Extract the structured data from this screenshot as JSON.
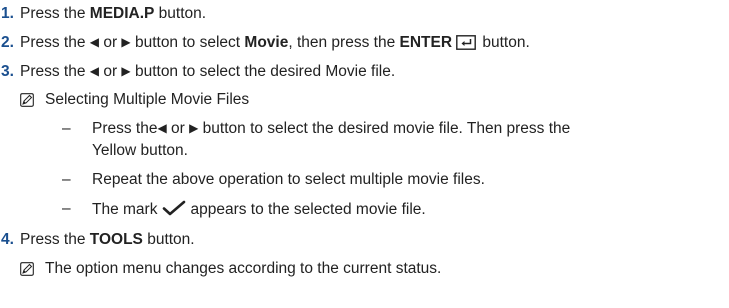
{
  "steps": [
    {
      "number": "1.",
      "pre": "Press the ",
      "bold": "MEDIA.P",
      "post": " button."
    },
    {
      "number": "2.",
      "pre": "Press the ",
      "left_arrow": "◀",
      "or": " or ",
      "right_arrow": "▶",
      "mid": " button to select ",
      "bold1": "Movie",
      "mid2": ", then press the ",
      "bold2": "ENTER",
      "enter_icon": "enter-icon",
      "post": " button."
    },
    {
      "number": "3.",
      "pre": "Press the ",
      "left_arrow": "◀",
      "or": " or ",
      "right_arrow": "▶",
      "post": " button to select the desired Movie file.",
      "note": {
        "icon": "note-icon",
        "text": "Selecting Multiple Movie Files"
      },
      "subitems": [
        {
          "dash": "–",
          "line1_pre": "Press the",
          "left_arrow": "◀",
          "or": " or ",
          "right_arrow": "▶",
          "line1_post": " button to select the desired movie file. Then press the",
          "line2": "Yellow button."
        },
        {
          "dash": "–",
          "text": "Repeat the above operation to select multiple movie files."
        },
        {
          "dash": "–",
          "pre": "The mark",
          "check_icon": "checkmark-icon",
          "post": "appears to the selected movie file."
        }
      ]
    },
    {
      "number": "4.",
      "pre": "Press the ",
      "bold": "TOOLS",
      "post": " button.",
      "note": {
        "icon": "note-icon",
        "text": "The option menu changes according to the current status."
      }
    }
  ]
}
